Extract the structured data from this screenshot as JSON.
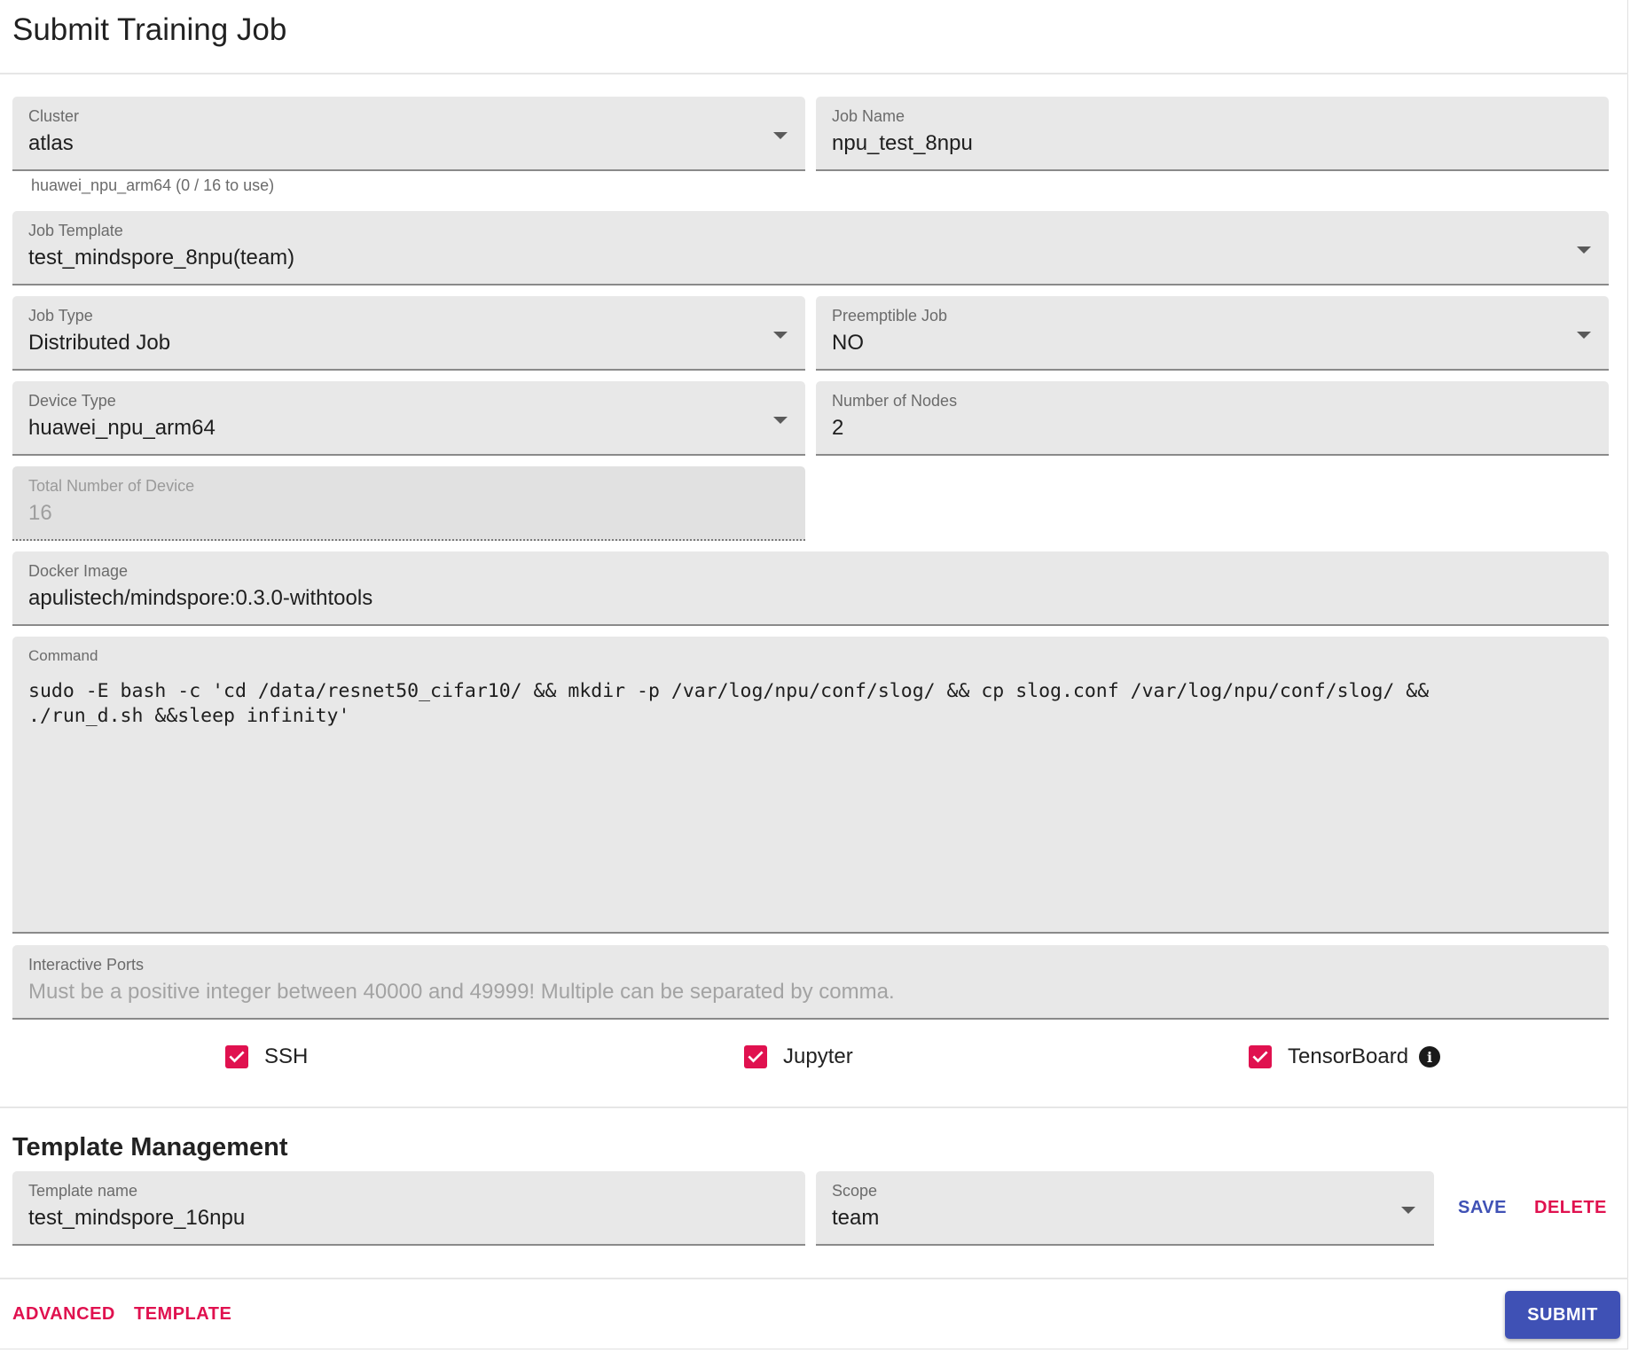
{
  "page": {
    "title": "Submit Training Job"
  },
  "form": {
    "cluster": {
      "label": "Cluster",
      "value": "atlas",
      "helper": "huawei_npu_arm64 (0 / 16 to use)"
    },
    "job_name": {
      "label": "Job Name",
      "value": "npu_test_8npu"
    },
    "job_template": {
      "label": "Job Template",
      "value": "test_mindspore_8npu(team)"
    },
    "job_type": {
      "label": "Job Type",
      "value": "Distributed Job"
    },
    "preemptible": {
      "label": "Preemptible Job",
      "value": "NO"
    },
    "device_type": {
      "label": "Device Type",
      "value": "huawei_npu_arm64"
    },
    "num_nodes": {
      "label": "Number of Nodes",
      "value": "2"
    },
    "total_devices": {
      "label": "Total Number of Device",
      "value": "16"
    },
    "docker_image": {
      "label": "Docker Image",
      "value": "apulistech/mindspore:0.3.0-withtools"
    },
    "command": {
      "label": "Command",
      "value": "sudo -E bash -c 'cd /data/resnet50_cifar10/ && mkdir -p /var/log/npu/conf/slog/ && cp slog.conf /var/log/npu/conf/slog/ && ./run_d.sh &&sleep infinity'"
    },
    "interactive_ports": {
      "label": "Interactive Ports",
      "placeholder": "Must be a positive integer between 40000 and 49999!  Multiple can be separated by comma."
    },
    "checkboxes": {
      "ssh": {
        "label": "SSH",
        "checked": true
      },
      "jupyter": {
        "label": "Jupyter",
        "checked": true
      },
      "tensorboard": {
        "label": "TensorBoard",
        "checked": true
      }
    }
  },
  "template_management": {
    "title": "Template Management",
    "template_name": {
      "label": "Template name",
      "value": "test_mindspore_16npu"
    },
    "scope": {
      "label": "Scope",
      "value": "team"
    },
    "save_label": "SAVE",
    "delete_label": "DELETE"
  },
  "footer": {
    "advanced_label": "ADVANCED",
    "template_label": "TEMPLATE",
    "submit_label": "SUBMIT"
  },
  "colors": {
    "accent": "#e0114f",
    "primary": "#3f51b5",
    "field_bg": "#e8e8e8"
  },
  "icons": {
    "dropdown": "chevron-down-icon",
    "checkbox": "check-icon",
    "info": "info-icon"
  }
}
